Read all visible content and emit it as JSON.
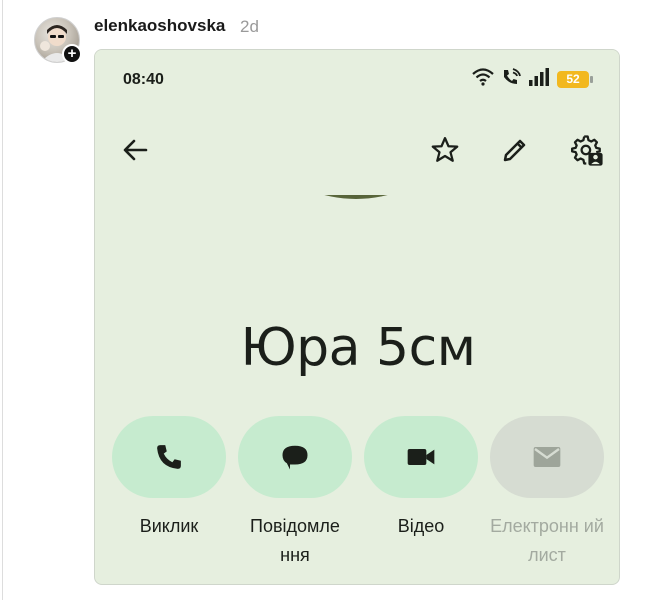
{
  "post": {
    "username": "elenkaoshovska",
    "time": "2d",
    "follow_symbol": "+"
  },
  "phone": {
    "status_time": "08:40",
    "battery_level": "52",
    "contact_name": "Юра 5см",
    "actions": [
      {
        "label": "Виклик",
        "icon": "phone-icon",
        "enabled": true
      },
      {
        "label": "Повідомле ння",
        "icon": "message-icon",
        "enabled": true
      },
      {
        "label": "Відео",
        "icon": "video-icon",
        "enabled": true
      },
      {
        "label": "Електронн ий лист",
        "icon": "email-icon",
        "enabled": false
      }
    ],
    "toolbar_icons": [
      "back-arrow-icon",
      "star-icon",
      "edit-pencil-icon",
      "contact-settings-icon"
    ],
    "colors": {
      "background": "#e6efdf",
      "action_pill": "#c6ebcf",
      "action_pill_disabled": "#d6dcd2",
      "battery": "#f2b81f"
    }
  }
}
